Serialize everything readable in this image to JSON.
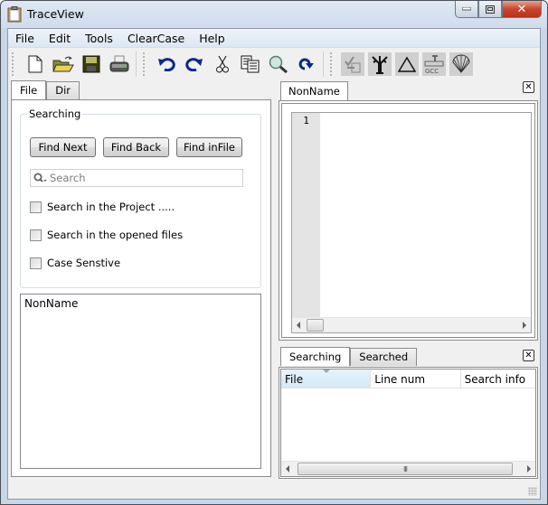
{
  "window": {
    "title": "TraceView",
    "controls": {
      "minimize": "–",
      "maximize": "□",
      "close": "✕"
    }
  },
  "menubar": {
    "items": [
      {
        "label": "File"
      },
      {
        "label": "Edit"
      },
      {
        "label": "Tools"
      },
      {
        "label": "ClearCase"
      },
      {
        "label": "Help"
      }
    ]
  },
  "toolbar": {
    "groups": [
      [
        "new-file",
        "open-folder",
        "save",
        "print"
      ],
      [
        "undo",
        "redo",
        "cut",
        "paste",
        "find",
        "redo-arrow"
      ],
      [
        "checkin",
        "tree",
        "triangle",
        "gcc",
        "shell"
      ]
    ]
  },
  "left_panel": {
    "tabs": [
      {
        "label": "File",
        "active": true
      },
      {
        "label": "Dir",
        "active": false
      }
    ],
    "group_title": "Searching",
    "buttons": {
      "find_next": "Find Next",
      "find_back": "Find Back",
      "find_in_file": "Find inFile"
    },
    "search": {
      "placeholder": "Search",
      "value": ""
    },
    "checkboxes": [
      {
        "label": "Search in the Project .....",
        "checked": false
      },
      {
        "label": "Search in the opened files",
        "checked": false
      },
      {
        "label": "Case Senstive",
        "checked": false
      }
    ],
    "file_list": [
      "NonName"
    ]
  },
  "editor": {
    "tab_label": "NonName",
    "line_numbers": [
      "1"
    ],
    "content": ""
  },
  "results": {
    "tabs": [
      {
        "label": "Searching",
        "active": true
      },
      {
        "label": "Searched",
        "active": false
      }
    ],
    "columns": [
      "File",
      "Line num",
      "Search info"
    ],
    "rows": [],
    "scroll_thumb_glyph": "III"
  }
}
